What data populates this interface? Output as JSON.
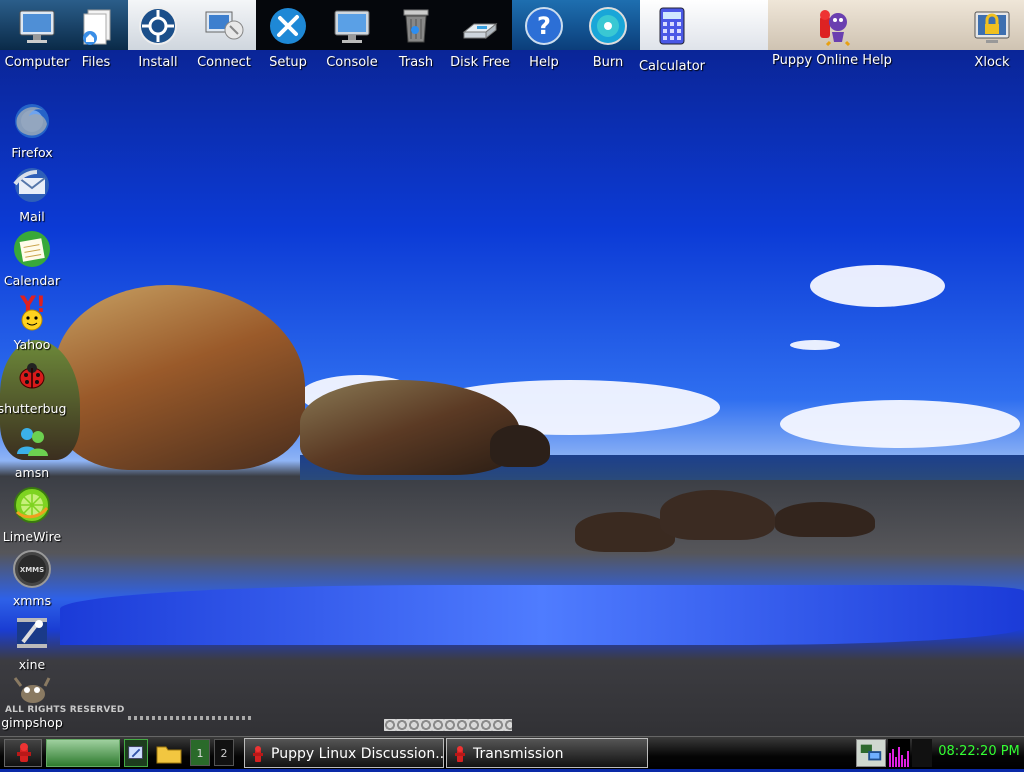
{
  "launcher": [
    {
      "label": "Computer",
      "icon": "monitor-icon"
    },
    {
      "label": "Files",
      "icon": "files-icon"
    },
    {
      "label": "Install",
      "icon": "install-icon"
    },
    {
      "label": "Connect",
      "icon": "connect-icon"
    },
    {
      "label": "Setup",
      "icon": "setup-tools-icon"
    },
    {
      "label": "Console",
      "icon": "console-icon"
    },
    {
      "label": "Trash",
      "icon": "trash-icon"
    },
    {
      "label": "Disk Free",
      "icon": "disk-icon"
    },
    {
      "label": "Help",
      "icon": "help-icon"
    },
    {
      "label": "Burn",
      "icon": "cd-burn-icon"
    },
    {
      "label": "Calculator",
      "icon": "calculator-icon"
    },
    {
      "label": "Puppy Online Help",
      "icon": "puppy-help-icon"
    },
    {
      "label": "Xlock",
      "icon": "lock-icon"
    }
  ],
  "desktop_icons": [
    {
      "label": "Firefox",
      "icon": "firefox-icon"
    },
    {
      "label": "Mail",
      "icon": "mail-icon"
    },
    {
      "label": "Calendar",
      "icon": "calendar-icon"
    },
    {
      "label": "Yahoo",
      "icon": "yahoo-icon"
    },
    {
      "label": "shutterbug",
      "icon": "ladybug-icon"
    },
    {
      "label": "amsn",
      "icon": "amsn-icon"
    },
    {
      "label": "LimeWire",
      "icon": "limewire-icon"
    },
    {
      "label": "xmms",
      "icon": "xmms-icon"
    },
    {
      "label": "xine",
      "icon": "xine-icon"
    },
    {
      "label": "gimpshop",
      "icon": "gimp-icon"
    }
  ],
  "watermark": "ALL RIGHTS RESERVED",
  "taskbar": {
    "pager": [
      "1",
      "2"
    ],
    "tasks": [
      {
        "label": "Puppy Linux Discussion..."
      },
      {
        "label": "Transmission"
      }
    ],
    "clock": "08:22:20 PM"
  },
  "colors": {
    "clock": "#33ff33",
    "desktop": "#0c3bd6",
    "taskbar": "#000000"
  }
}
